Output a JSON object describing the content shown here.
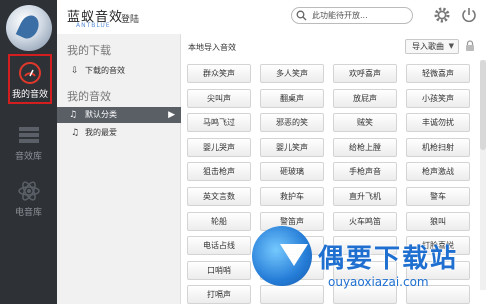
{
  "app": {
    "name": "蓝蚁音效",
    "sub": "ANTBLUE",
    "login": "登陆"
  },
  "search": {
    "placeholder": "此功能待开放..."
  },
  "nav": [
    {
      "label": "我的音效",
      "icon": "gauge-icon",
      "active": true
    },
    {
      "label": "音效库",
      "icon": "bars-icon",
      "active": false
    },
    {
      "label": "电音库",
      "icon": "atom-icon",
      "active": false
    }
  ],
  "mid": {
    "downloads_title": "我的下载",
    "downloads_item": "下载的音效",
    "effects_title": "我的音效",
    "items": [
      "默认分类",
      "我的最爱"
    ]
  },
  "content": {
    "title": "本地导入音效",
    "import": "导入歌曲",
    "buttons": [
      "群众笑声",
      "多人笑声",
      "欢呼喜声",
      "轻微喜声",
      "尖叫声",
      "翻桌声",
      "放屁声",
      "小孩笑声",
      "马鸣飞过",
      "邪恶的笑",
      "贼笑",
      "丰诚勿扰",
      "婴儿哭声",
      "婴儿笑声",
      "给枪上膛",
      "机枪扫射",
      "狙击枪声",
      "砸玻璃",
      "手枪声音",
      "枪声激战",
      "英文言数",
      "救护车",
      "直升飞机",
      "警车",
      "轮船",
      "警笛声",
      "火车鸣笛",
      "狼叫",
      "电话占线",
      "",
      "",
      "打脸喜悦",
      "口哨哨",
      "",
      "",
      "",
      "打嗝声",
      "",
      "",
      ""
    ]
  },
  "watermark": {
    "text": "偶要下载站",
    "url": "ouyaoxiazai.com"
  }
}
